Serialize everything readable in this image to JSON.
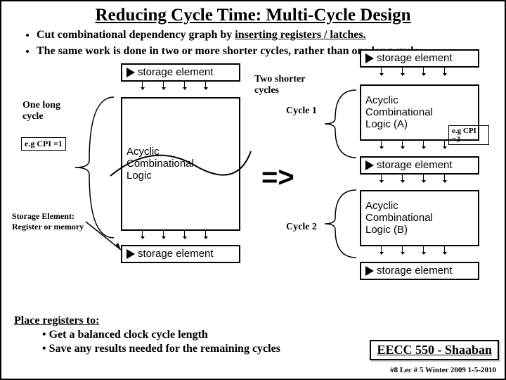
{
  "title": "Reducing Cycle Time:  Multi-Cycle Design",
  "bullets": {
    "b1a": "Cut combinational dependency graph by ",
    "b1u": "inserting registers / latches.",
    "b2": "The same work is done in two or more shorter cycles, rather than one long cycle."
  },
  "labels": {
    "storage": "storage element",
    "acyclic_comb_logic": "Acyclic Combinational Logic",
    "acyclic_a": "Acyclic Combinational Logic (A)",
    "acyclic_b": "Acyclic Combinational Logic (B)",
    "one_long_cycle": "One long cycle",
    "cpi1": "e.g CPI =1",
    "cpi2": "e.g CPI =2",
    "two_shorter": "Two shorter cycles",
    "cycle1": "Cycle 1",
    "cycle2": "Cycle 2",
    "transform": "=>",
    "storage_note": "Storage Element: Register or memory"
  },
  "bottom": {
    "lead": "Place registers to:",
    "p1": "• Get a balanced clock cycle length",
    "p2": "• Save any results needed for the remaining cycles"
  },
  "course": {
    "code": "EECC 550",
    "sep": " - ",
    "author": "Shaaban"
  },
  "footer": "#8   Lec # 5  Winter 2009  1-5-2010"
}
